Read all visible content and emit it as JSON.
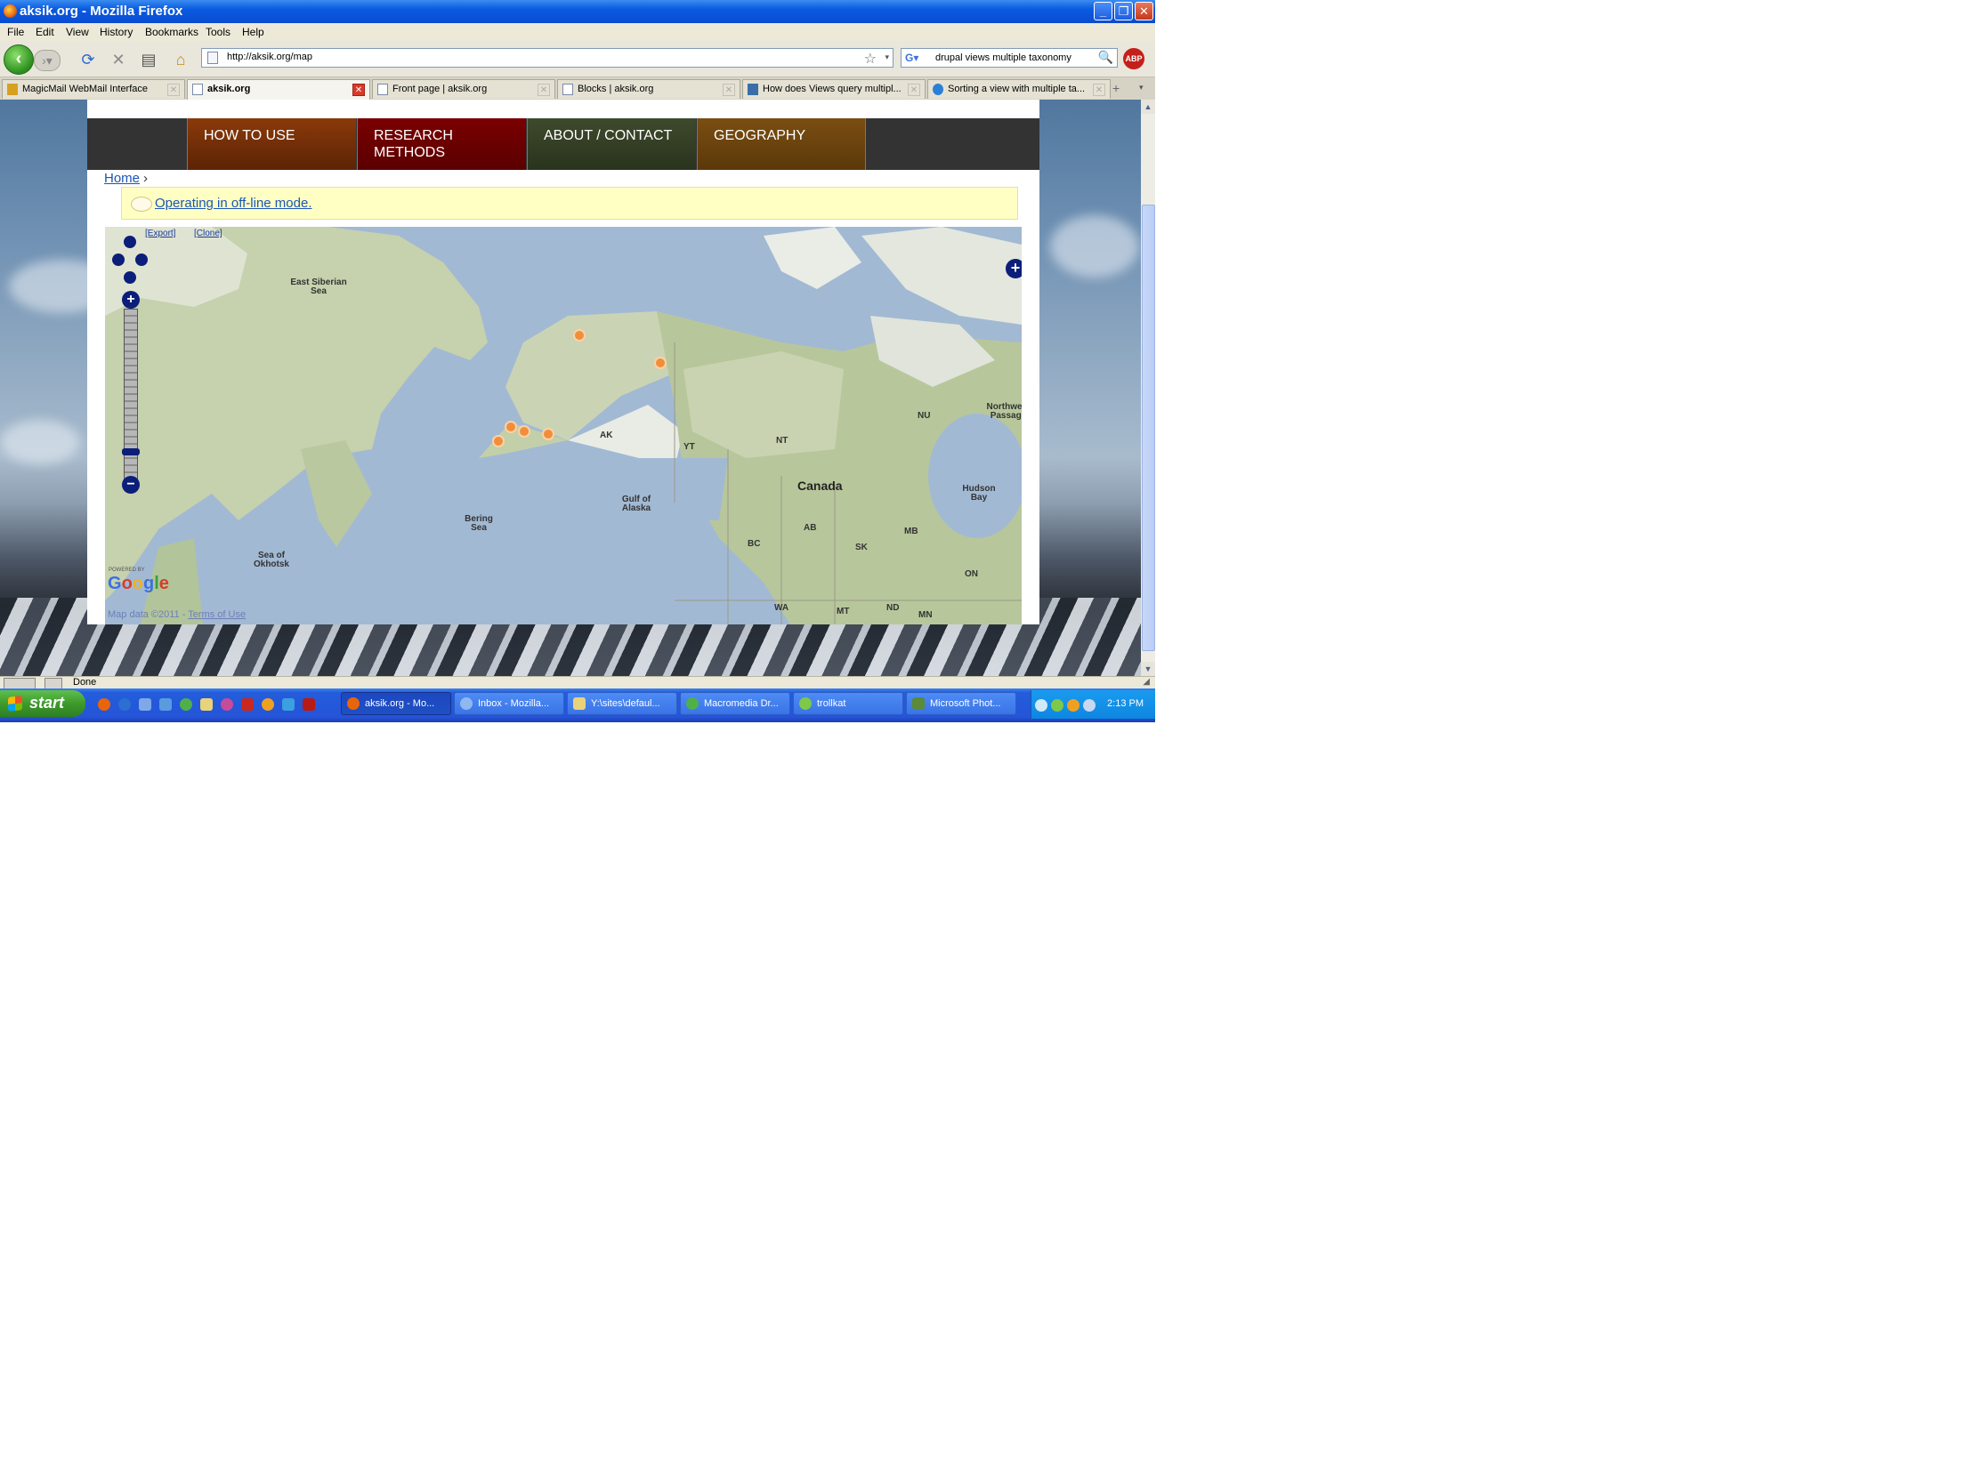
{
  "window": {
    "title": "aksik.org - Mozilla Firefox",
    "minimize": "_",
    "maximize": "❐",
    "close": "✕"
  },
  "menu": [
    "File",
    "Edit",
    "View",
    "History",
    "Bookmarks",
    "Tools",
    "Help"
  ],
  "toolbar": {
    "url": "http://aksik.org/map",
    "search_query": "drupal views multiple taxonomy",
    "abp_label": "ABP"
  },
  "tabs": [
    {
      "label": "MagicMail WebMail Interface"
    },
    {
      "label": "aksik.org",
      "active": true
    },
    {
      "label": "Front page | aksik.org"
    },
    {
      "label": "Blocks | aksik.org"
    },
    {
      "label": "How does Views query multipl..."
    },
    {
      "label": "Sorting a view with multiple ta..."
    }
  ],
  "site_nav": [
    {
      "label": "HOW TO USE"
    },
    {
      "label": "RESEARCH METHODS"
    },
    {
      "label": "ABOUT / CONTACT"
    },
    {
      "label": "GEOGRAPHY"
    }
  ],
  "breadcrumb": {
    "home": "Home",
    "sep": "›"
  },
  "message": "Operating in off-line mode.",
  "map": {
    "links": {
      "export": "[Export]",
      "clone": "[Clone]"
    },
    "labels": {
      "east_siberian_sea": "East Siberian Sea",
      "bering_sea": "Bering Sea",
      "sea_of_okhotsk": "Sea of Okhotsk",
      "gulf_of_alaska": "Gulf of Alaska",
      "canada": "Canada",
      "hudson_bay": "Hudson Bay",
      "northwest_passage": "Northwest Passage",
      "ak": "AK",
      "yt": "YT",
      "nt": "NT",
      "nu": "NU",
      "bc": "BC",
      "ab": "AB",
      "sk": "SK",
      "mb": "MB",
      "on": "ON",
      "wa": "WA",
      "mt": "MT",
      "nd": "ND",
      "mn": "MN"
    },
    "powered_by": "POWERED BY",
    "google": "Google",
    "map_data": "Map data ©2011 -",
    "terms": "Terms of Use",
    "marker_count": 6
  },
  "status": {
    "text": "Done"
  },
  "taskbar": {
    "start": "start",
    "items": [
      {
        "label": "aksik.org - Mo...",
        "active": true
      },
      {
        "label": "Inbox - Mozilla..."
      },
      {
        "label": "Y:\\sites\\defaul..."
      },
      {
        "label": "Macromedia Dr..."
      },
      {
        "label": "trollkat"
      },
      {
        "label": "Microsoft Phot..."
      }
    ],
    "clock": "2:13 PM"
  }
}
